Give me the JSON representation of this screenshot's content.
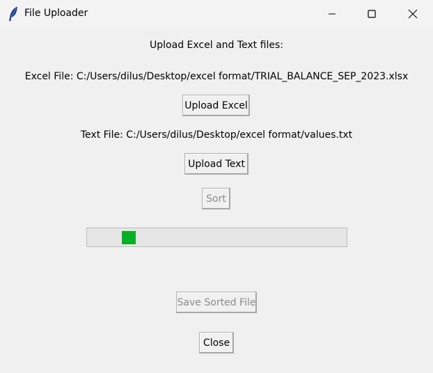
{
  "window": {
    "title": "File Uploader",
    "icon": "feather-icon"
  },
  "main": {
    "heading": "Upload Excel and Text files:",
    "excel_file_label": "Excel File: C:/Users/dilus/Desktop/excel format/TRIAL_BALANCE_SEP_2023.xlsx",
    "upload_excel_label": "Upload Excel",
    "text_file_label": "Text File: C:/Users/dilus/Desktop/excel format/values.txt",
    "upload_text_label": "Upload Text",
    "sort_label": "Sort",
    "sort_enabled": false,
    "progress": {
      "mode": "indeterminate",
      "color": "#06b025"
    },
    "save_label": "Save Sorted File",
    "save_enabled": false,
    "close_label": "Close"
  }
}
